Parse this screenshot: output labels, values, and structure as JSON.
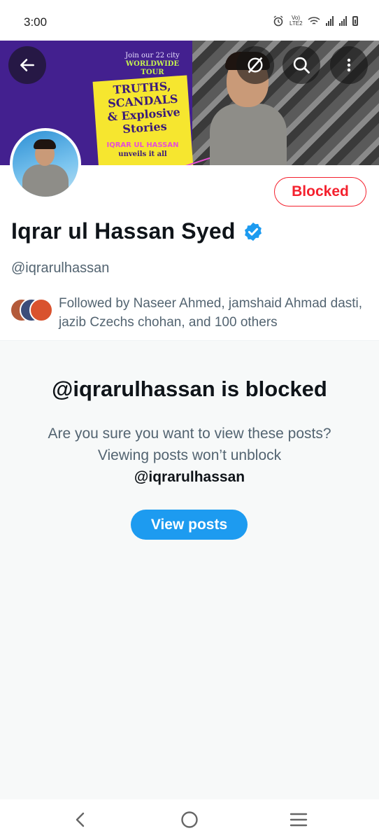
{
  "status_bar": {
    "time": "3:00",
    "network_label": "Vo) LTE2"
  },
  "banner": {
    "tour_line1": "Join our 22 city",
    "tour_line2": "WORLDWIDE TOUR",
    "headline": "TRUTHS, SCANDALS & Explosive Stories",
    "host_name": "IQRAR UL HASSAN",
    "tagline": "unveils it all"
  },
  "header": {
    "back_icon": "arrow-left-icon",
    "grok_icon": "grok-icon",
    "search_icon": "search-icon",
    "more_icon": "more-vertical-icon"
  },
  "profile": {
    "display_name": "Iqrar ul Hassan Syed",
    "verified": true,
    "handle": "@iqrarulhassan",
    "blocked_label": "Blocked",
    "followed_by": "Followed by Naseer Ahmed, jamshaid Ahmad dasti, jazib Czechs chohan, and 100 others"
  },
  "blocked_notice": {
    "title": "@iqrarulhassan is blocked",
    "message": "Are you sure you want to view these posts? Viewing posts won’t unblock",
    "handle": "@iqrarulhassan",
    "button_label": "View posts"
  },
  "colors": {
    "accent": "#1d9bf0",
    "blocked": "#f4212e",
    "secondary_text": "#536471"
  }
}
